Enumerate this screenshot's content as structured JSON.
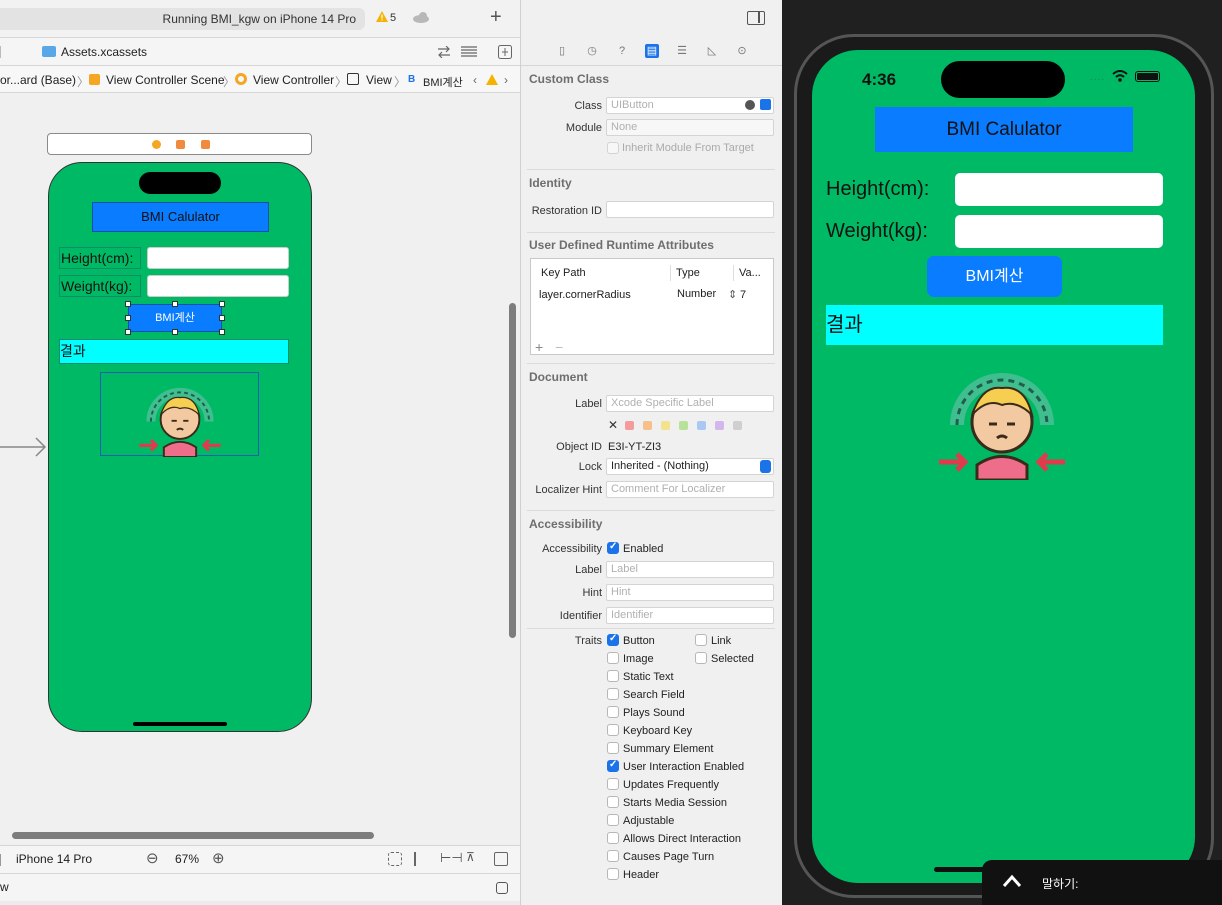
{
  "toolbar": {
    "status": "Running BMI_kgw on iPhone 14 Pro",
    "warning_count": "5"
  },
  "tab": {
    "label": "Assets.xcassets"
  },
  "breadcrumb": {
    "items": [
      "or...ard (Base)",
      "View Controller Scene",
      "View Controller",
      "View",
      "BMI계산"
    ]
  },
  "storyboard": {
    "title": "BMI Calulator",
    "height_label": "Height(cm):",
    "weight_label": "Weight(kg):",
    "button": "BMI계산",
    "result": "결과"
  },
  "canvas_footer": {
    "device": "iPhone 14 Pro",
    "zoom": "67%"
  },
  "debug_bar": {
    "text": "w"
  },
  "inspector": {
    "custom_class": {
      "title": "Custom Class",
      "class_label": "Class",
      "class_placeholder": "UIButton",
      "module_label": "Module",
      "module_placeholder": "None",
      "inherit": "Inherit Module From Target"
    },
    "identity": {
      "title": "Identity",
      "restoration_label": "Restoration ID"
    },
    "runtime": {
      "title": "User Defined Runtime Attributes",
      "headers": [
        "Key Path",
        "Type",
        "Va..."
      ],
      "row": {
        "key": "layer.cornerRadius",
        "type": "Number",
        "value": "7"
      }
    },
    "document": {
      "title": "Document",
      "label_label": "Label",
      "label_placeholder": "Xcode Specific Label",
      "object_id_label": "Object ID",
      "object_id": "E3I-YT-ZI3",
      "lock_label": "Lock",
      "lock_value": "Inherited - (Nothing)",
      "localizer_label": "Localizer Hint",
      "localizer_placeholder": "Comment For Localizer"
    },
    "accessibility": {
      "title": "Accessibility",
      "acc_label": "Accessibility",
      "acc_enabled": "Enabled",
      "label_label": "Label",
      "label_placeholder": "Label",
      "hint_label": "Hint",
      "hint_placeholder": "Hint",
      "identifier_label": "Identifier",
      "identifier_placeholder": "Identifier",
      "traits_label": "Traits",
      "traits": [
        {
          "name": "Button",
          "checked": true
        },
        {
          "name": "Link",
          "checked": false
        },
        {
          "name": "Image",
          "checked": false
        },
        {
          "name": "Selected",
          "checked": false
        },
        {
          "name": "Static Text",
          "checked": false
        },
        {
          "name": "Search Field",
          "checked": false
        },
        {
          "name": "Plays Sound",
          "checked": false
        },
        {
          "name": "Keyboard Key",
          "checked": false
        },
        {
          "name": "Summary Element",
          "checked": false
        },
        {
          "name": "User Interaction Enabled",
          "checked": true
        },
        {
          "name": "Updates Frequently",
          "checked": false
        },
        {
          "name": "Starts Media Session",
          "checked": false
        },
        {
          "name": "Adjustable",
          "checked": false
        },
        {
          "name": "Allows Direct Interaction",
          "checked": false
        },
        {
          "name": "Causes Page Turn",
          "checked": false
        },
        {
          "name": "Header",
          "checked": false
        }
      ]
    }
  },
  "simulator": {
    "time": "4:36",
    "title": "BMI Calulator",
    "height_label": "Height(cm):",
    "weight_label": "Weight(kg):",
    "button": "BMI계산",
    "result": "결과"
  },
  "dictation": {
    "label": "말하기:"
  },
  "colors": {
    "app_background": "#00b964",
    "button_blue": "#0a7cff",
    "result_cyan": "#00ffff"
  }
}
